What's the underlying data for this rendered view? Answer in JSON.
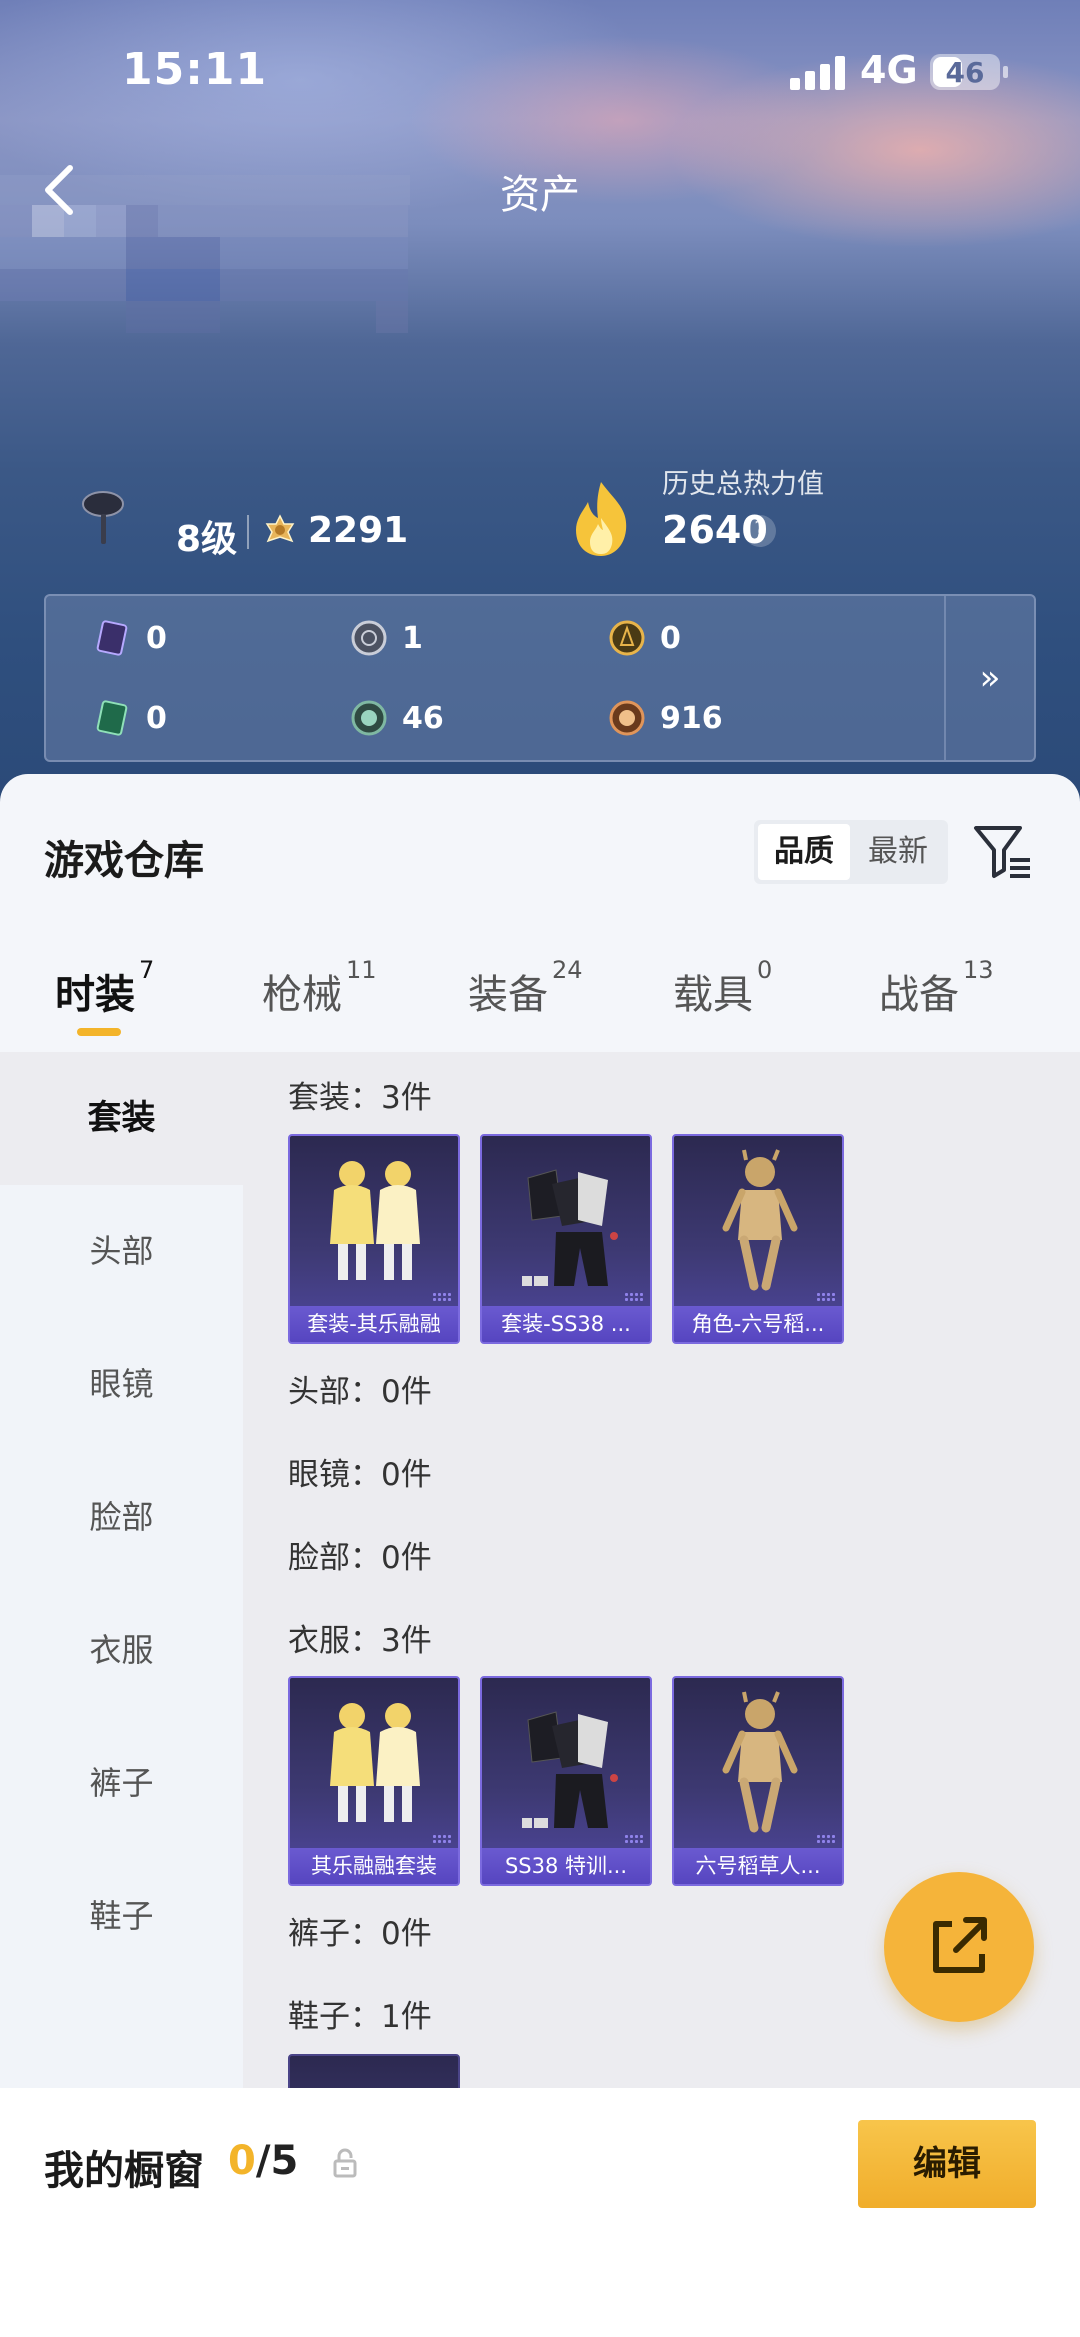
{
  "status_bar": {
    "time": "15:11",
    "network": "4G",
    "battery": "46",
    "battery_level": 0.46
  },
  "header": {
    "title": "资产"
  },
  "profile": {
    "level": "8级",
    "rank_score": "2291",
    "history_heat_label": "历史总热力值",
    "history_heat_value": "2640",
    "help": "?"
  },
  "currencies": [
    {
      "icon": "purple-card-icon",
      "value": "0"
    },
    {
      "icon": "silver-coin-icon",
      "value": "1"
    },
    {
      "icon": "gold-coin-icon",
      "value": "0"
    },
    {
      "icon": "green-card-icon",
      "value": "0"
    },
    {
      "icon": "green-gem-icon",
      "value": "46"
    },
    {
      "icon": "bronze-coin-icon",
      "value": "916"
    }
  ],
  "more_label": "»",
  "warehouse": {
    "title": "游戏仓库",
    "sort_options": [
      "品质",
      "最新"
    ],
    "selected_sort": "品质"
  },
  "tabs": [
    {
      "label": "时装",
      "count": "7"
    },
    {
      "label": "枪械",
      "count": "11"
    },
    {
      "label": "装备",
      "count": "24"
    },
    {
      "label": "载具",
      "count": "0"
    },
    {
      "label": "战备",
      "count": "13"
    }
  ],
  "active_tab": "时装",
  "categories": [
    "套装",
    "头部",
    "眼镜",
    "脸部",
    "衣服",
    "裤子",
    "鞋子"
  ],
  "active_category": "套装",
  "sections": [
    {
      "label": "套装：3件",
      "items": [
        "套装-其乐融融",
        "套装-SS38 ...",
        "角色-六号稻..."
      ]
    },
    {
      "label": "头部：0件",
      "items": []
    },
    {
      "label": "眼镜：0件",
      "items": []
    },
    {
      "label": "脸部：0件",
      "items": []
    },
    {
      "label": "衣服：3件",
      "items": [
        "其乐融融套装",
        "SS38 特训...",
        "六号稻草人..."
      ]
    },
    {
      "label": "裤子：0件",
      "items": []
    },
    {
      "label": "鞋子：1件",
      "items": [
        ""
      ]
    }
  ],
  "showcase": {
    "title": "我的橱窗",
    "filled": "0",
    "total": "/5",
    "edit_label": "编辑"
  },
  "colors": {
    "accent": "#f3b42a",
    "card_border": "#7b6adf",
    "card_bg": "#3d3972"
  }
}
